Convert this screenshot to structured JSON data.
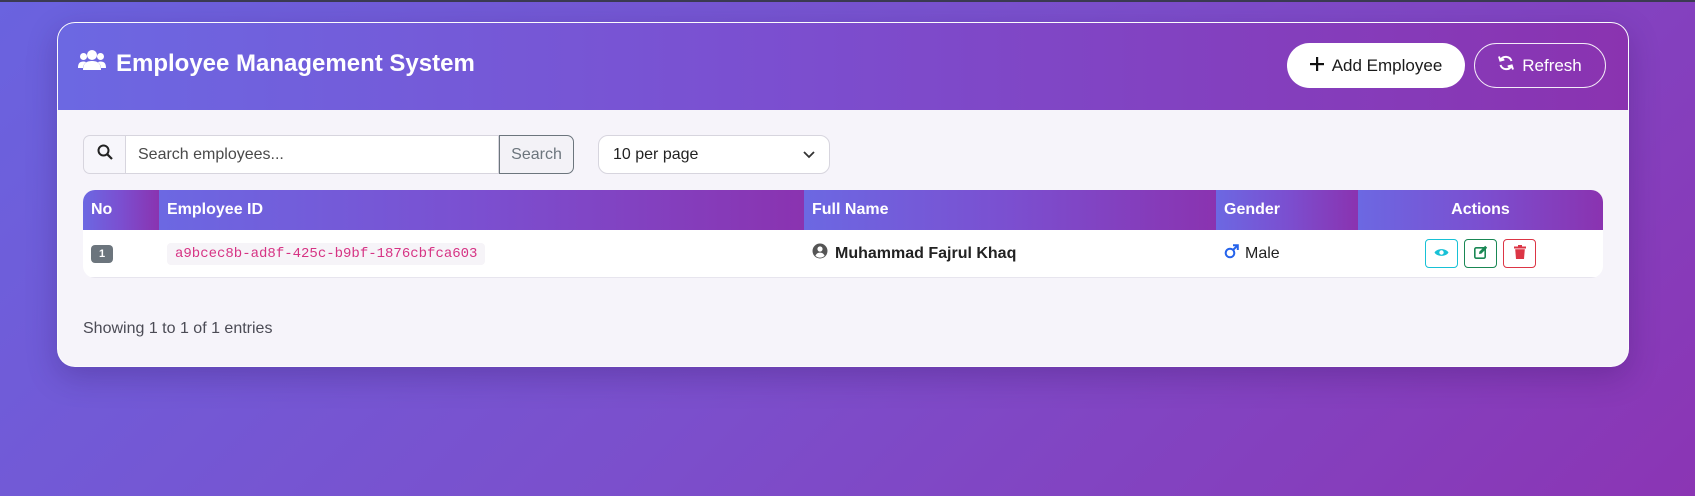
{
  "header": {
    "title": "Employee Management System",
    "add_label": "Add Employee",
    "refresh_label": "Refresh"
  },
  "toolbar": {
    "search_placeholder": "Search employees...",
    "search_button": "Search",
    "per_page_selected": "10 per page"
  },
  "table": {
    "columns": [
      "No",
      "Employee ID",
      "Full Name",
      "Gender",
      "Actions"
    ],
    "rows": [
      {
        "no": "1",
        "employee_id": "a9bcec8b-ad8f-425c-b9bf-1876cbfca603",
        "full_name": "Muhammad Fajrul Khaq",
        "gender": "Male"
      }
    ]
  },
  "footer": {
    "info": "Showing 1 to 1 of 1 entries"
  },
  "colors": {
    "accent_start": "#6c68e2",
    "accent_end": "#8a33b0",
    "id_text": "#d63384",
    "view": "#17c1d6",
    "edit": "#198754",
    "delete": "#dc3545",
    "gender_male": "#2563eb"
  },
  "icons": {
    "title": "users-icon",
    "add": "plus-icon",
    "refresh": "refresh-icon",
    "search": "search-icon",
    "dropdown": "chevron-down-icon",
    "person": "user-circle-icon",
    "gender": "mars-icon",
    "view": "eye-icon",
    "edit": "edit-icon",
    "delete": "trash-icon"
  }
}
